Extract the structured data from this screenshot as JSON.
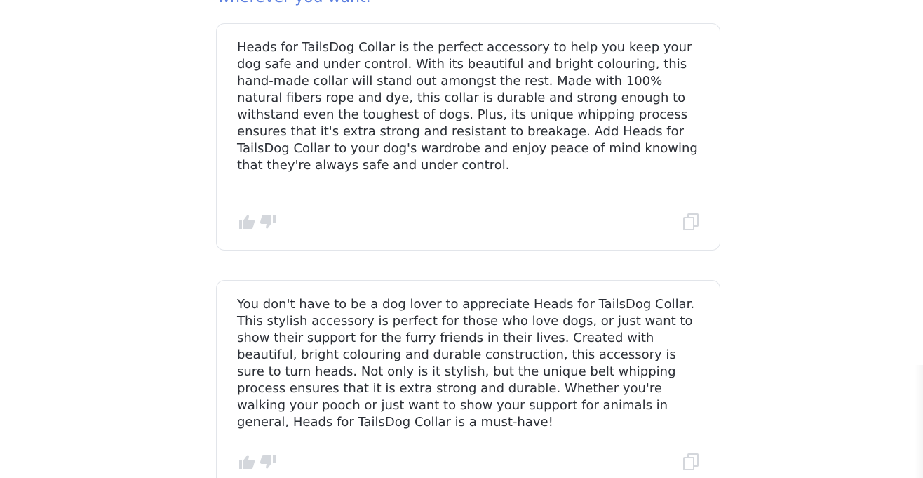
{
  "top_text_cutoff": "wherever you want.",
  "cards": [
    {
      "text": "Heads for TailsDog Collar is the perfect accessory to help you keep your dog safe and under control. With its beautiful and bright colouring, this hand-made collar will stand out amongst the rest. Made with 100% natural fibers rope and dye, this collar is durable and strong enough to withstand even the toughest of dogs. Plus, its unique whipping process ensures that it's extra strong and resistant to breakage. Add Heads for TailsDog Collar to your dog's wardrobe and enjoy peace of mind knowing that they're always safe and under control."
    },
    {
      "text": "You don't have to be a dog lover to appreciate Heads for TailsDog Collar. This stylish accessory is perfect for those who love dogs, or just want to show their support for the furry friends in their lives. Created with beautiful, bright colouring and durable construction, this accessory is sure to turn heads. Not only is it stylish, but the unique belt whipping process ensures that it is extra strong and durable. Whether you're walking your pooch or just want to show your support for animals in general, Heads for TailsDog Collar is a must-have!"
    }
  ],
  "icons": {
    "thumbs_up": "thumbs-up-icon",
    "thumbs_down": "thumbs-down-icon",
    "copy": "copy-icon"
  },
  "colors": {
    "text": "#2b2f36",
    "icon": "#d4d7dc",
    "border": "#e2e5ea",
    "link": "#5b7fe0"
  }
}
